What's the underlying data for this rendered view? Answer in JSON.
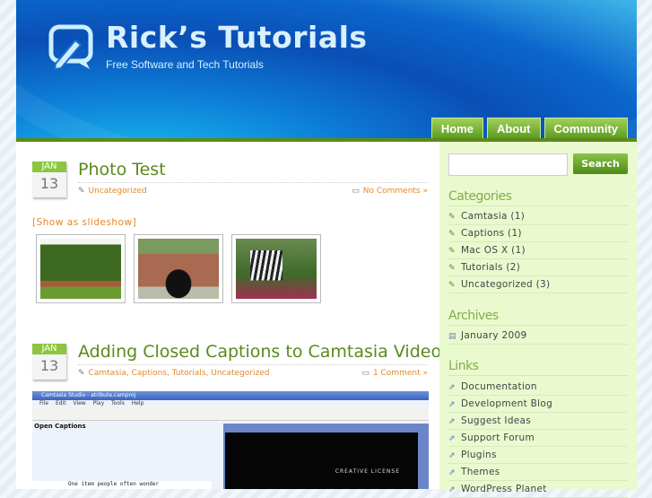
{
  "header": {
    "title": "Rick’s Tutorials",
    "tagline": "Free Software and Tech Tutorials"
  },
  "nav": [
    "Home",
    "About",
    "Community"
  ],
  "posts": [
    {
      "month": "JAN",
      "day": "13",
      "title": "Photo Test",
      "categories": "Uncategorized",
      "comments": "No Comments »",
      "slideshow": "[Show as slideshow]"
    },
    {
      "month": "JAN",
      "day": "13",
      "title": "Adding Closed Captions to Camtasia Videos",
      "categories": "Camtasia, Captions, Tutorials, Uncategorized",
      "comments": "1 Comment »",
      "screenshot": {
        "window_title": "Camtasia Studio - atribute.camproj",
        "menu": "File Edit View Play Tools Help",
        "panel": "Open Captions",
        "caption_text": "One item people often wonder",
        "preview_text": "CREATIVE LICENSE"
      }
    }
  ],
  "sidebar": {
    "search_button": "Search",
    "categories_title": "Categories",
    "categories": [
      "Camtasia (1)",
      "Captions (1)",
      "Mac OS X (1)",
      "Tutorials (2)",
      "Uncategorized (3)"
    ],
    "archives_title": "Archives",
    "archives": [
      "January 2009"
    ],
    "links_title": "Links",
    "links": [
      "Documentation",
      "Development Blog",
      "Suggest Ideas",
      "Support Forum",
      "Plugins",
      "Themes",
      "WordPress Planet"
    ]
  }
}
